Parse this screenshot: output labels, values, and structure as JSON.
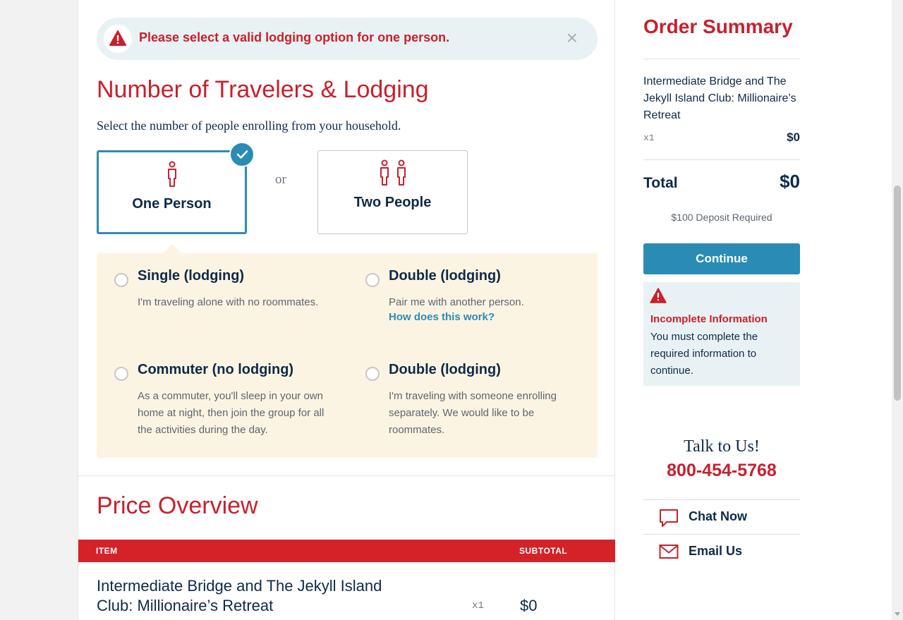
{
  "alert": {
    "message": "Please select a valid lodging option for one person.",
    "close_glyph": "×"
  },
  "travelers": {
    "heading": "Number of Travelers & Lodging",
    "subtext": "Select the number of people enrolling from your household.",
    "separator": "or",
    "options": [
      {
        "label": "One Person",
        "icon": "person-icon",
        "selected": true
      },
      {
        "label": "Two People",
        "icon": "two-people-icon",
        "selected": false
      }
    ]
  },
  "lodging": {
    "options": [
      {
        "title": "Single (lodging)",
        "desc": "I'm traveling alone with no roommates.",
        "link": ""
      },
      {
        "title": "Double (lodging)",
        "desc": "Pair me with another person.",
        "link": "How does this work?"
      },
      {
        "title": "Commuter (no lodging)",
        "desc": "As a commuter, you'll sleep in your own home at night, then join the group for all the activities during the day.",
        "link": ""
      },
      {
        "title": "Double (lodging)",
        "desc": "I'm traveling with someone enrolling separately. We would like to be roommates.",
        "link": ""
      }
    ]
  },
  "price_overview": {
    "heading": "Price Overview",
    "columns": {
      "item": "ITEM",
      "subtotal": "SUBTOTAL"
    },
    "rows": [
      {
        "item": "Intermediate Bridge and The Jekyll Island Club: Millionaire’s Retreat",
        "qty": "x1",
        "subtotal": "$0"
      }
    ]
  },
  "order_summary": {
    "title": "Order Summary",
    "item": "Intermediate Bridge and The Jekyll Island Club: Millionaire’s Retreat",
    "qty": "x1",
    "price": "$0",
    "total_label": "Total",
    "total_value": "$0",
    "deposit": "$100 Deposit Required",
    "continue_label": "Continue",
    "warning": {
      "title": "Incomplete Information",
      "text": "You must complete the required information to continue."
    }
  },
  "contact": {
    "talk": "Talk to Us!",
    "phone": "800-454-5768",
    "chat_label": "Chat Now",
    "email_label": "Email Us"
  },
  "colors": {
    "brand_red": "#c8202e",
    "accent_blue": "#2a8cb4",
    "navy_text": "#0e2a4a",
    "panel_cream": "#fcf4e2",
    "alert_bg": "#e8f2f4",
    "table_header_red": "#d42228"
  }
}
